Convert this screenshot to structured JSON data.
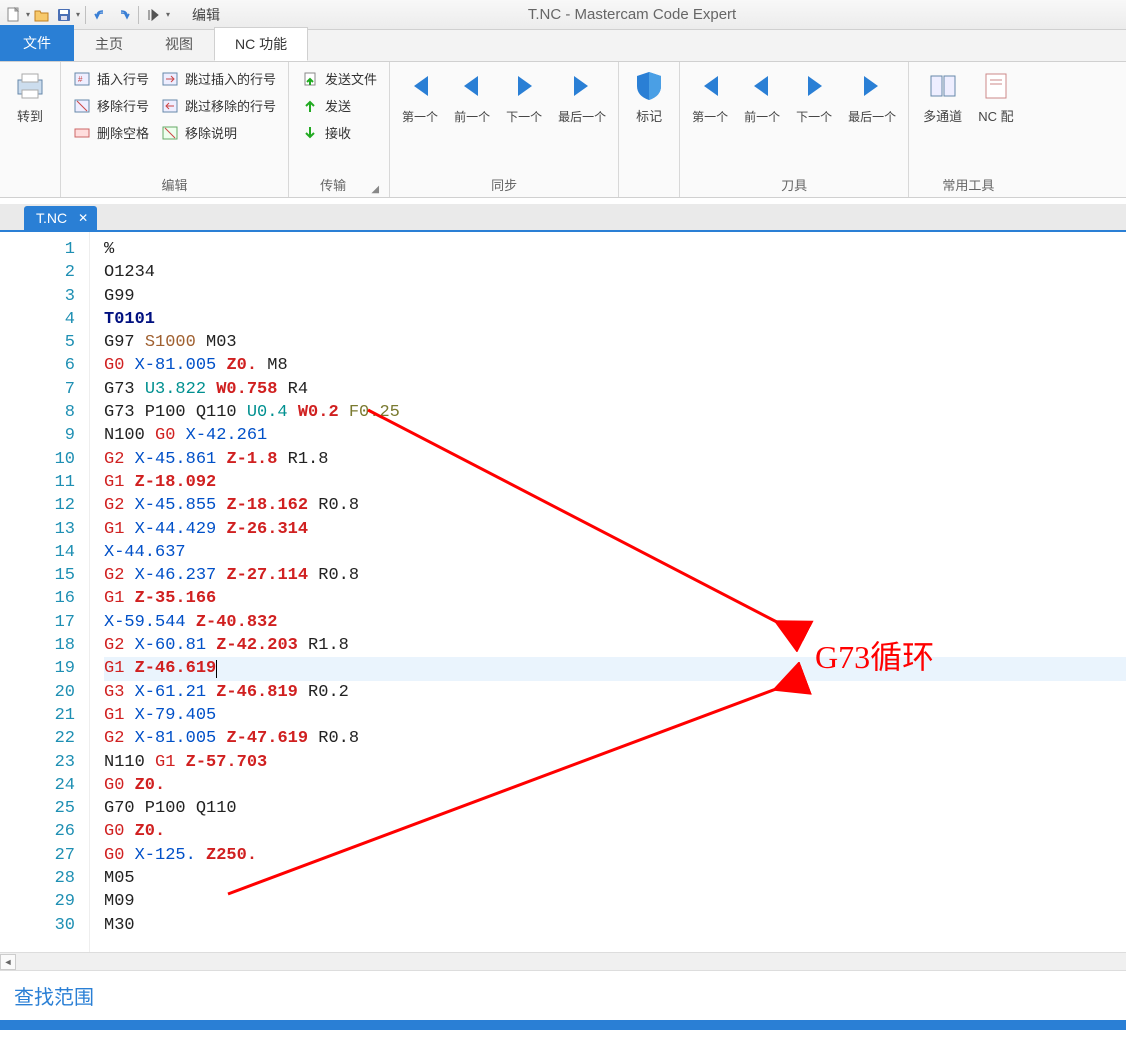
{
  "title": "T.NC - Mastercam Code Expert",
  "qat_edit_menu": "编辑",
  "tabs": {
    "file": "文件",
    "home": "主页",
    "view": "视图",
    "nc": "NC 功能"
  },
  "ribbon": {
    "goto": {
      "label": "转到"
    },
    "edit": {
      "label": "编辑",
      "insert_line_no": "插入行号",
      "remove_line_no": "移除行号",
      "delete_spaces": "删除空格",
      "skip_insert": "跳过插入的行号",
      "skip_remove": "跳过移除的行号",
      "remove_desc": "移除说明"
    },
    "transfer": {
      "label": "传输",
      "send_file": "发送文件",
      "send": "发送",
      "receive": "接收"
    },
    "sync": {
      "label": "同步",
      "first": "第一个",
      "prev": "前一个",
      "next": "下一个",
      "last": "最后一个"
    },
    "mark": {
      "label": "标记"
    },
    "tool": {
      "label": "刀具",
      "first": "第一个",
      "prev": "前一个",
      "next": "下一个",
      "last": "最后一个"
    },
    "common": {
      "label": "常用工具",
      "multi": "多通道",
      "nc": "NC\n配"
    }
  },
  "doc_tab": "T.NC",
  "annotation": "G73循环",
  "findbar": "查找范围",
  "code": [
    {
      "n": 1,
      "tokens": [
        {
          "t": "%",
          "c": "t-black"
        }
      ]
    },
    {
      "n": 2,
      "tokens": [
        {
          "t": "O1234",
          "c": "t-black"
        }
      ]
    },
    {
      "n": 3,
      "tokens": [
        {
          "t": "G99",
          "c": "t-black"
        }
      ]
    },
    {
      "n": 4,
      "tokens": [
        {
          "t": "T0101",
          "c": "t-navy"
        }
      ]
    },
    {
      "n": 5,
      "tokens": [
        {
          "t": "G97 ",
          "c": "t-black"
        },
        {
          "t": "S1000",
          "c": "t-brown"
        },
        {
          "t": " M03",
          "c": "t-black"
        }
      ]
    },
    {
      "n": 6,
      "tokens": [
        {
          "t": "G0",
          "c": "t-redn"
        },
        {
          "t": " ",
          "c": "t-black"
        },
        {
          "t": "X-81.005",
          "c": "t-blue"
        },
        {
          "t": " ",
          "c": "t-black"
        },
        {
          "t": "Z0.",
          "c": "t-red"
        },
        {
          "t": " M8",
          "c": "t-black"
        }
      ]
    },
    {
      "n": 7,
      "tokens": [
        {
          "t": "G73 ",
          "c": "t-black"
        },
        {
          "t": "U3.822",
          "c": "t-teal"
        },
        {
          "t": " ",
          "c": "t-black"
        },
        {
          "t": "W0.758",
          "c": "t-red"
        },
        {
          "t": " R4",
          "c": "t-black"
        }
      ]
    },
    {
      "n": 8,
      "tokens": [
        {
          "t": "G73 P100 Q110 ",
          "c": "t-black"
        },
        {
          "t": "U0.4",
          "c": "t-teal"
        },
        {
          "t": " ",
          "c": "t-black"
        },
        {
          "t": "W0.2",
          "c": "t-red"
        },
        {
          "t": " ",
          "c": "t-black"
        },
        {
          "t": "F0.25",
          "c": "t-olive"
        }
      ]
    },
    {
      "n": 9,
      "tokens": [
        {
          "t": "N100 ",
          "c": "t-black"
        },
        {
          "t": "G0",
          "c": "t-redn"
        },
        {
          "t": " ",
          "c": "t-black"
        },
        {
          "t": "X-42.261",
          "c": "t-blue"
        }
      ]
    },
    {
      "n": 10,
      "tokens": [
        {
          "t": "G2",
          "c": "t-redn"
        },
        {
          "t": " ",
          "c": "t-black"
        },
        {
          "t": "X-45.861",
          "c": "t-blue"
        },
        {
          "t": " ",
          "c": "t-black"
        },
        {
          "t": "Z-1.8",
          "c": "t-red"
        },
        {
          "t": " R1.8",
          "c": "t-black"
        }
      ]
    },
    {
      "n": 11,
      "tokens": [
        {
          "t": "G1",
          "c": "t-redn"
        },
        {
          "t": " ",
          "c": "t-black"
        },
        {
          "t": "Z-18.092",
          "c": "t-red"
        }
      ]
    },
    {
      "n": 12,
      "tokens": [
        {
          "t": "G2",
          "c": "t-redn"
        },
        {
          "t": " ",
          "c": "t-black"
        },
        {
          "t": "X-45.855",
          "c": "t-blue"
        },
        {
          "t": " ",
          "c": "t-black"
        },
        {
          "t": "Z-18.162",
          "c": "t-red"
        },
        {
          "t": " R0.8",
          "c": "t-black"
        }
      ]
    },
    {
      "n": 13,
      "tokens": [
        {
          "t": "G1",
          "c": "t-redn"
        },
        {
          "t": " ",
          "c": "t-black"
        },
        {
          "t": "X-44.429",
          "c": "t-blue"
        },
        {
          "t": " ",
          "c": "t-black"
        },
        {
          "t": "Z-26.314",
          "c": "t-red"
        }
      ]
    },
    {
      "n": 14,
      "tokens": [
        {
          "t": "X-44.637",
          "c": "t-blue"
        }
      ]
    },
    {
      "n": 15,
      "tokens": [
        {
          "t": "G2",
          "c": "t-redn"
        },
        {
          "t": " ",
          "c": "t-black"
        },
        {
          "t": "X-46.237",
          "c": "t-blue"
        },
        {
          "t": " ",
          "c": "t-black"
        },
        {
          "t": "Z-27.114",
          "c": "t-red"
        },
        {
          "t": " R0.8",
          "c": "t-black"
        }
      ]
    },
    {
      "n": 16,
      "tokens": [
        {
          "t": "G1",
          "c": "t-redn"
        },
        {
          "t": " ",
          "c": "t-black"
        },
        {
          "t": "Z-35.166",
          "c": "t-red"
        }
      ]
    },
    {
      "n": 17,
      "tokens": [
        {
          "t": "X-59.544",
          "c": "t-blue"
        },
        {
          "t": " ",
          "c": "t-black"
        },
        {
          "t": "Z-40.832",
          "c": "t-red"
        }
      ]
    },
    {
      "n": 18,
      "tokens": [
        {
          "t": "G2",
          "c": "t-redn"
        },
        {
          "t": " ",
          "c": "t-black"
        },
        {
          "t": "X-60.81",
          "c": "t-blue"
        },
        {
          "t": " ",
          "c": "t-black"
        },
        {
          "t": "Z-42.203",
          "c": "t-red"
        },
        {
          "t": " R1.8",
          "c": "t-black"
        }
      ]
    },
    {
      "n": 19,
      "hl": true,
      "tokens": [
        {
          "t": "G1",
          "c": "t-redn"
        },
        {
          "t": " ",
          "c": "t-black"
        },
        {
          "t": "Z-46.619",
          "c": "t-red"
        }
      ],
      "cursor": true
    },
    {
      "n": 20,
      "tokens": [
        {
          "t": "G3",
          "c": "t-redn"
        },
        {
          "t": " ",
          "c": "t-black"
        },
        {
          "t": "X-61.21",
          "c": "t-blue"
        },
        {
          "t": " ",
          "c": "t-black"
        },
        {
          "t": "Z-46.819",
          "c": "t-red"
        },
        {
          "t": " R0.2",
          "c": "t-black"
        }
      ]
    },
    {
      "n": 21,
      "tokens": [
        {
          "t": "G1",
          "c": "t-redn"
        },
        {
          "t": " ",
          "c": "t-black"
        },
        {
          "t": "X-79.405",
          "c": "t-blue"
        }
      ]
    },
    {
      "n": 22,
      "tokens": [
        {
          "t": "G2",
          "c": "t-redn"
        },
        {
          "t": " ",
          "c": "t-black"
        },
        {
          "t": "X-81.005",
          "c": "t-blue"
        },
        {
          "t": " ",
          "c": "t-black"
        },
        {
          "t": "Z-47.619",
          "c": "t-red"
        },
        {
          "t": " R0.8",
          "c": "t-black"
        }
      ]
    },
    {
      "n": 23,
      "tokens": [
        {
          "t": "N110 ",
          "c": "t-black"
        },
        {
          "t": "G1",
          "c": "t-redn"
        },
        {
          "t": " ",
          "c": "t-black"
        },
        {
          "t": "Z-57.703",
          "c": "t-red"
        }
      ]
    },
    {
      "n": 24,
      "tokens": [
        {
          "t": "G0",
          "c": "t-redn"
        },
        {
          "t": " ",
          "c": "t-black"
        },
        {
          "t": "Z0.",
          "c": "t-red"
        }
      ]
    },
    {
      "n": 25,
      "tokens": [
        {
          "t": "G70 P100 Q110",
          "c": "t-black"
        }
      ]
    },
    {
      "n": 26,
      "tokens": [
        {
          "t": "G0",
          "c": "t-redn"
        },
        {
          "t": " ",
          "c": "t-black"
        },
        {
          "t": "Z0.",
          "c": "t-red"
        }
      ]
    },
    {
      "n": 27,
      "tokens": [
        {
          "t": "G0",
          "c": "t-redn"
        },
        {
          "t": " ",
          "c": "t-black"
        },
        {
          "t": "X-125.",
          "c": "t-blue"
        },
        {
          "t": " ",
          "c": "t-black"
        },
        {
          "t": "Z250.",
          "c": "t-red"
        }
      ]
    },
    {
      "n": 28,
      "tokens": [
        {
          "t": "M05",
          "c": "t-black"
        }
      ]
    },
    {
      "n": 29,
      "tokens": [
        {
          "t": "M09",
          "c": "t-black"
        }
      ]
    },
    {
      "n": 30,
      "tokens": [
        {
          "t": "M30",
          "c": "t-black"
        }
      ]
    }
  ]
}
